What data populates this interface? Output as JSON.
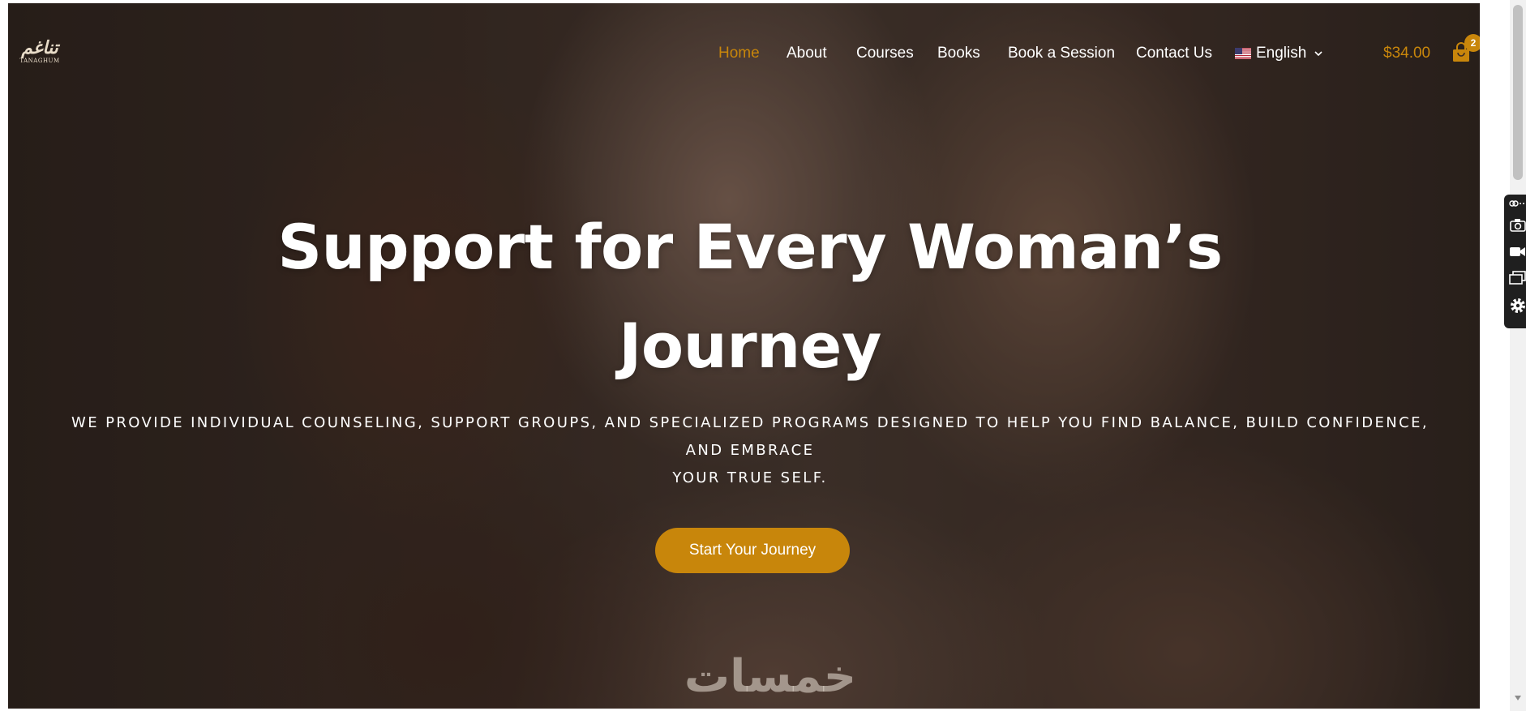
{
  "brand": {
    "logo_mark": "ﺗﻨﺎﻏﻢ",
    "logo_sub": "TANAGHUM"
  },
  "nav": {
    "items": [
      {
        "label": "Home",
        "active": true
      },
      {
        "label": "About",
        "active": false
      },
      {
        "label": "Courses",
        "active": false
      },
      {
        "label": "Books",
        "active": false
      },
      {
        "label": "Book a Session",
        "active": false
      },
      {
        "label": "Contact Us",
        "active": false
      }
    ],
    "language": "English",
    "language_flag": "us-flag-icon"
  },
  "cart": {
    "total": "$34.00",
    "count": "2",
    "icon": "shopping-bag-icon"
  },
  "hero": {
    "title_line1": "Support for Every Woman’s",
    "title_line2": "Journey",
    "subtitle_line1": "We provide individual counseling, support groups, and specialized programs designed to help you find balance, build confidence, and embrace",
    "subtitle_line2": "your true self.",
    "cta_label": "Start Your Journey",
    "watermark": "خمسات"
  },
  "toolbar_icons": [
    "link-icon",
    "camera-icon",
    "video-icon",
    "screens-icon",
    "gear-icon"
  ],
  "colors": {
    "accent": "#c8860b",
    "text_on_dark": "#ffffff"
  }
}
